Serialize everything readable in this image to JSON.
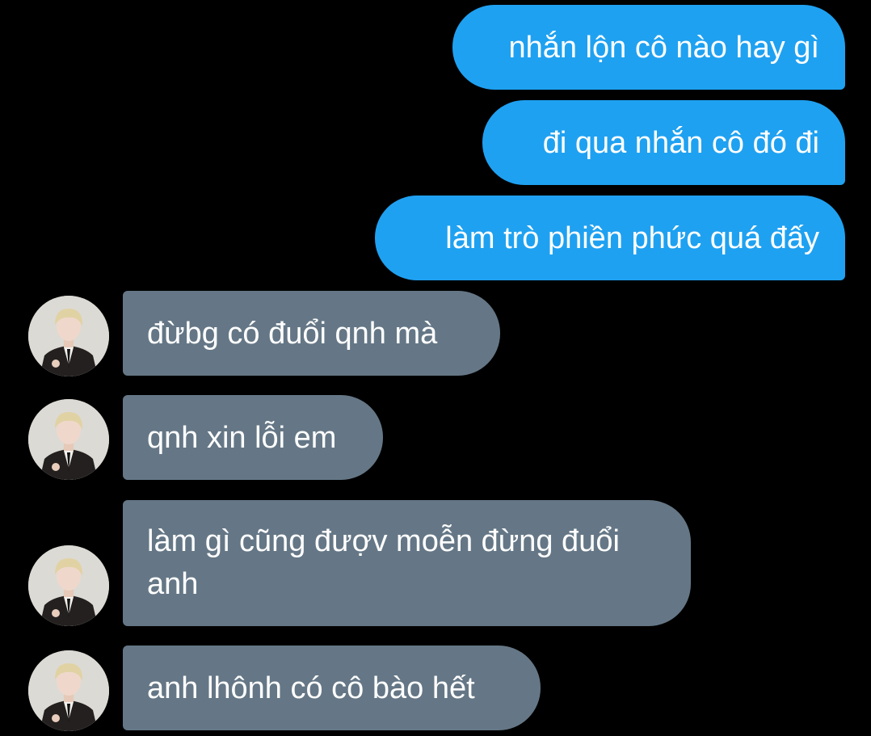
{
  "messages": [
    {
      "side": "sent",
      "text": "nhắn lộn cô nào hay gì"
    },
    {
      "side": "sent",
      "text": "đi qua nhắn cô đó đi"
    },
    {
      "side": "sent",
      "text": "làm trò phiền phức quá đấy"
    },
    {
      "side": "received",
      "text": "đừbg có đuổi qnh mà",
      "avatar": "profile-photo"
    },
    {
      "side": "received",
      "text": "qnh xin lỗi em",
      "avatar": "profile-photo"
    },
    {
      "side": "received",
      "text": "làm gì cũng đượv moễn đừng đuổi anh",
      "avatar": "profile-photo"
    },
    {
      "side": "received",
      "text": "anh lhônh có cô bào hết",
      "avatar": "profile-photo"
    }
  ],
  "colors": {
    "background": "#000000",
    "sent_bubble": "#1fa1f1",
    "received_bubble": "#657786",
    "text": "#ffffff"
  }
}
